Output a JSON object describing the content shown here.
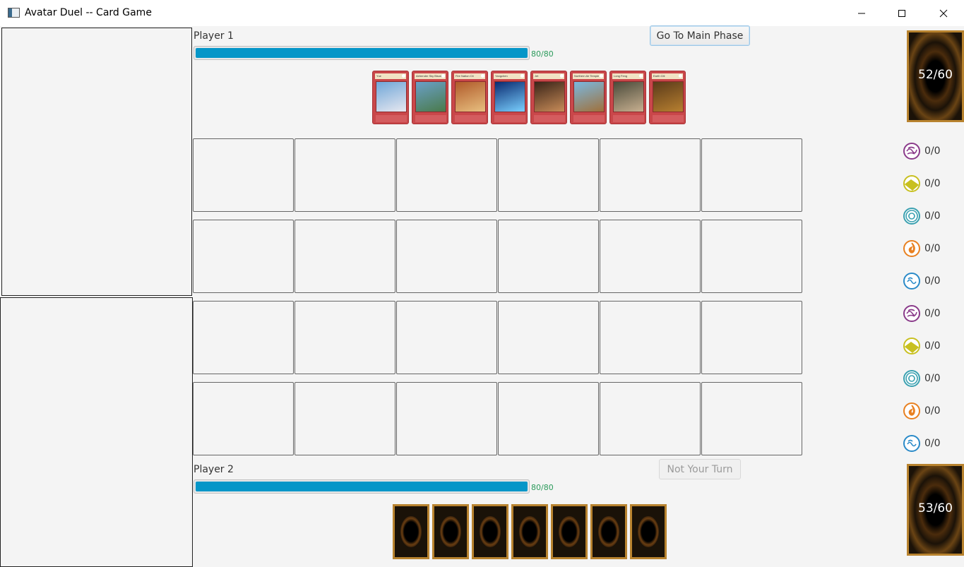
{
  "window": {
    "title": "Avatar Duel -- Card Game"
  },
  "player1": {
    "label": "Player 1",
    "hp_text": "80/80",
    "hp_fraction": 1.0,
    "button_label": "Go To Main Phase",
    "hand": [
      {
        "name": "Yue",
        "palette": [
          "#6fa6d8",
          "#e8e8f0"
        ]
      },
      {
        "name": "Airbender Sky Bison",
        "palette": [
          "#6aa0c8",
          "#4a7a4a"
        ]
      },
      {
        "name": "Fire Nation Cit",
        "palette": [
          "#b05a2a",
          "#e8c080"
        ]
      },
      {
        "name": "Yangchen",
        "palette": [
          "#0a2a70",
          "#7ad0ff"
        ]
      },
      {
        "name": "Jet",
        "palette": [
          "#3a2418",
          "#c88c58"
        ]
      },
      {
        "name": "Northern Air Temple",
        "palette": [
          "#7ab8e0",
          "#a0703a"
        ]
      },
      {
        "name": "Long Feng",
        "palette": [
          "#4a4a3a",
          "#c8b090"
        ]
      },
      {
        "name": "Earth Citi",
        "palette": [
          "#5a3a1a",
          "#b88030"
        ]
      }
    ],
    "deck_count": "52/60"
  },
  "player2": {
    "label": "Player 2",
    "hp_text": "80/80",
    "hp_fraction": 1.0,
    "button_label": "Not Your Turn",
    "hand_count": 7,
    "deck_count": "53/60"
  },
  "energies": [
    {
      "icon": "air-energy-icon",
      "color": "#8a3a8a",
      "value": "0/0"
    },
    {
      "icon": "earth-energy-icon",
      "color": "#c8c020",
      "value": "0/0"
    },
    {
      "icon": "air-element-icon",
      "color": "#3aa0b0",
      "value": "0/0"
    },
    {
      "icon": "fire-energy-icon",
      "color": "#e88020",
      "value": "0/0"
    },
    {
      "icon": "water-energy-icon",
      "color": "#2a8ac8",
      "value": "0/0"
    },
    {
      "icon": "air-energy-icon",
      "color": "#8a3a8a",
      "value": "0/0"
    },
    {
      "icon": "earth-energy-icon",
      "color": "#c8c020",
      "value": "0/0"
    },
    {
      "icon": "air-element-icon",
      "color": "#3aa0b0",
      "value": "0/0"
    },
    {
      "icon": "fire-energy-icon",
      "color": "#e88020",
      "value": "0/0"
    },
    {
      "icon": "water-energy-icon",
      "color": "#2a8ac8",
      "value": "0/0"
    }
  ],
  "board": {
    "rows": 4,
    "cols": 6
  }
}
